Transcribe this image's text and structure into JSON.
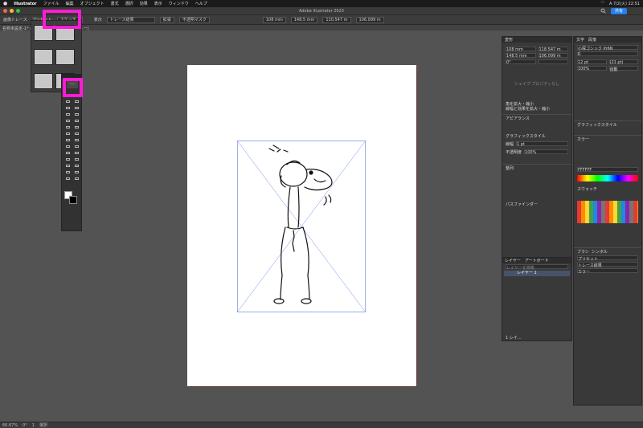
{
  "menubar": {
    "app": "Illustrator",
    "items": [
      "ファイル",
      "編集",
      "オブジェクト",
      "書式",
      "選択",
      "効果",
      "表示",
      "ウィンドウ",
      "ヘルプ"
    ],
    "clock": "A 7/2(火) 22:51"
  },
  "window": {
    "title": "Adobe Illustrator 2023",
    "share": "共有"
  },
  "control_bar": {
    "mode": "画像トレース",
    "preset_label": "プリセット",
    "preset_value": "スケッチ",
    "view_label": "表示",
    "view_value": "トレース結果",
    "expand_button": "拡張",
    "mask_button": "不透明マスク",
    "x": "108 mm",
    "y": "148.5 mm",
    "w": "110.547 m",
    "h": "106.099 m"
  },
  "document_tab": "名称未設定-1* @ 66.67 % (CMYK/プレビュー)",
  "tool_panel": {
    "more_tools": "…"
  },
  "properties_panel": {
    "tabs": [
      "変形"
    ],
    "x": "108 mm",
    "y": "148.5 mm",
    "w": "118.547 m",
    "h": "106.099 m",
    "angle": "0°",
    "placeholder": "シェイプ プロパティなし",
    "opt1": "角を拡大・縮小",
    "opt2": "線幅と効果を拡大・縮小",
    "appearance": "アピアランス",
    "graphic_style": "グラフィックスタイル",
    "stroke_label": "線幅",
    "stroke_value": "1 pt",
    "opacity_label": "不透明度",
    "opacity_value": "100%",
    "section_align": "整列",
    "section_path": "パスファインダー",
    "layers_tabs": [
      "レイヤー",
      "アートボード"
    ],
    "layer_search": "レイヤーを検索",
    "layer_name": "レイヤー 1",
    "layer_count": "1 レイ..."
  },
  "character_panel": {
    "tabs": [
      "文字",
      "段落"
    ],
    "font": "小塚ゴシック Pr6N",
    "style": "R",
    "size": "12 pt",
    "leading": "(21 pt)",
    "tracking": "100%",
    "kern": "自動",
    "graphic_style": "グラフィックスタイル",
    "color_tab": "カラー",
    "hex": "FFFFFF",
    "swatch_tab": "スウォッチ",
    "brush_tab": "ブラシ",
    "symbol_tab": "シンボル",
    "trace_tab": "画像トレース",
    "trace_preset": "プリセット",
    "trace_view": "トレース結果",
    "trace_mode": "カラー"
  },
  "status_bar": {
    "zoom": "66.67%",
    "rotation": "0°",
    "artboard": "1",
    "tool": "選択"
  },
  "colors": {
    "highlight": "#ff1ad5",
    "accent": "#2680eb"
  }
}
